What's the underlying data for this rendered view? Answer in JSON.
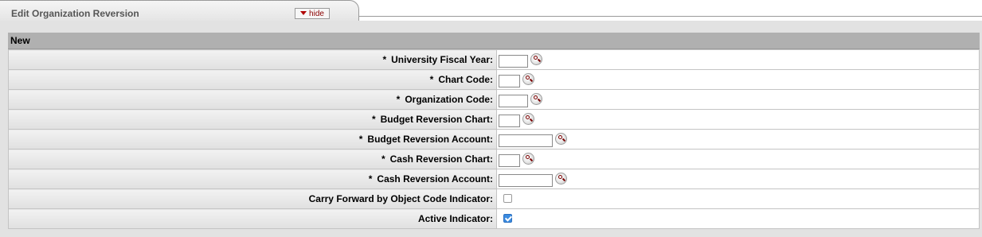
{
  "tab": {
    "title": "Edit Organization Reversion",
    "hide_label": "hide"
  },
  "section": {
    "header": "New"
  },
  "fields": [
    {
      "required": "*",
      "label": "University Fiscal Year:",
      "value": "",
      "type": "text",
      "lookup_icon": "magnifier-icon"
    },
    {
      "required": "*",
      "label": "Chart Code:",
      "value": "",
      "type": "text",
      "lookup_icon": "magnifier-icon"
    },
    {
      "required": "*",
      "label": "Organization Code:",
      "value": "",
      "type": "text",
      "lookup_icon": "magnifier-icon"
    },
    {
      "required": "*",
      "label": "Budget Reversion Chart:",
      "value": "",
      "type": "text",
      "lookup_icon": "magnifier-icon"
    },
    {
      "required": "*",
      "label": "Budget Reversion Account:",
      "value": "",
      "type": "text",
      "lookup_icon": "magnifier-icon"
    },
    {
      "required": "*",
      "label": "Cash Reversion Chart:",
      "value": "",
      "type": "text",
      "lookup_icon": "magnifier-icon"
    },
    {
      "required": "*",
      "label": "Cash Reversion Account:",
      "value": "",
      "type": "text",
      "lookup_icon": "magnifier-icon"
    },
    {
      "required": "",
      "label": "Carry Forward by Object Code Indicator:",
      "value": "unchecked",
      "type": "checkbox"
    },
    {
      "required": "",
      "label": "Active Indicator:",
      "value": "checked",
      "type": "checkbox"
    }
  ],
  "colors": {
    "header_bg": "#b0b0b0",
    "checkbox_checked": "#3b8be0",
    "hide_text": "#8b0000"
  }
}
